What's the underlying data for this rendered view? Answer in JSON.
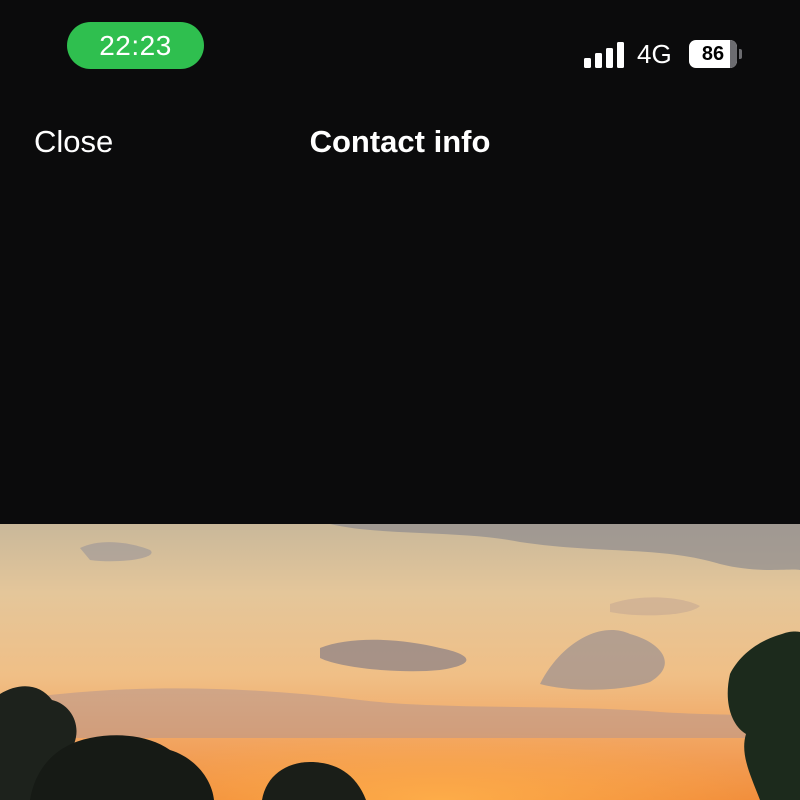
{
  "status_bar": {
    "time": "22:23",
    "network": "4G",
    "battery_level": "86",
    "battery_fraction": 0.86,
    "signal_bars": 4,
    "time_pill_color": "#2fbf4f"
  },
  "nav": {
    "close_label": "Close",
    "title": "Contact info"
  },
  "profile_photo": {
    "icon": "sunset-landscape-photo"
  }
}
